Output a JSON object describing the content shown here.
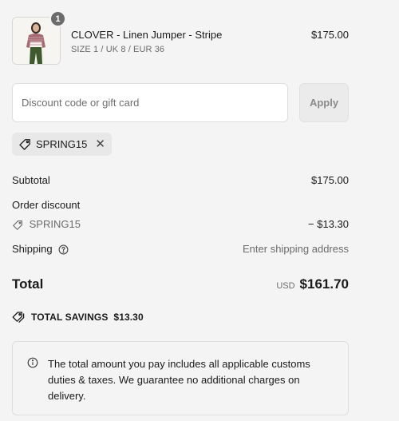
{
  "line_item": {
    "quantity": "1",
    "title": "CLOVER - Linen Jumper - Stripe",
    "variant": "SIZE 1 / UK 8 / EUR 36",
    "price": "$175.00"
  },
  "discount": {
    "placeholder": "Discount code or gift card",
    "apply_label": "Apply",
    "applied_code": "SPRING15"
  },
  "summary": {
    "subtotal_label": "Subtotal",
    "subtotal_value": "$175.00",
    "order_discount_label": "Order discount",
    "discount_code": "SPRING15",
    "discount_value": "− $13.30",
    "shipping_label": "Shipping",
    "shipping_value": "Enter shipping address",
    "total_label": "Total",
    "total_currency": "USD",
    "total_value": "$161.70"
  },
  "savings": {
    "label": "TOTAL SAVINGS",
    "value": "$13.30"
  },
  "notice": {
    "text": "The total amount you pay includes all applicable customs duties & taxes. We guarantee no additional charges on delivery."
  },
  "colors": {
    "background": "#f4f4f4",
    "text": "#1a1a1a",
    "muted": "#6b6b6b",
    "badge": "#6b6b6b"
  },
  "icons": [
    "tag-icon",
    "close-icon",
    "help-circle-icon",
    "info-icon"
  ]
}
